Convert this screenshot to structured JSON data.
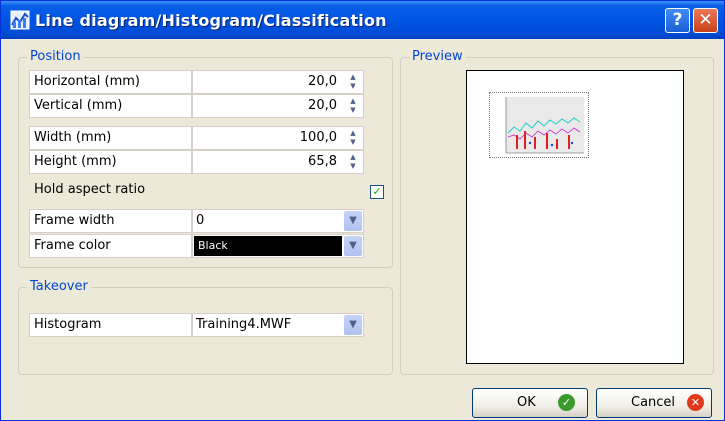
{
  "window": {
    "title": "Line diagram/Histogram/Classification",
    "help_label": "?",
    "close_label": "✕"
  },
  "position": {
    "legend": "Position",
    "horizontal": {
      "label": "Horizontal  (mm)",
      "value": "20,0"
    },
    "vertical": {
      "label": "Vertical (mm)",
      "value": "20,0"
    },
    "width": {
      "label": "Width (mm)",
      "value": "100,0"
    },
    "height": {
      "label": "Height (mm)",
      "value": "65,8"
    },
    "hold_aspect": {
      "label": "Hold aspect ratio",
      "checked": true
    },
    "frame_width": {
      "label": "Frame width",
      "value": "0"
    },
    "frame_color": {
      "label": "Frame color",
      "value": "Black",
      "swatch": "#000000"
    }
  },
  "takeover": {
    "legend": "Takeover",
    "histogram": {
      "label": "Histogram",
      "value": "Training4.MWF"
    }
  },
  "preview": {
    "legend": "Preview"
  },
  "buttons": {
    "ok_label": "OK",
    "cancel_label": "Cancel"
  },
  "icons": {
    "up": "spin-up-icon",
    "down": "spin-down-icon",
    "dropdown": "chevron-down-icon"
  },
  "colors": {
    "accent": "#0046d5",
    "ok": "#3a9b2c",
    "cancel": "#e0391c"
  }
}
